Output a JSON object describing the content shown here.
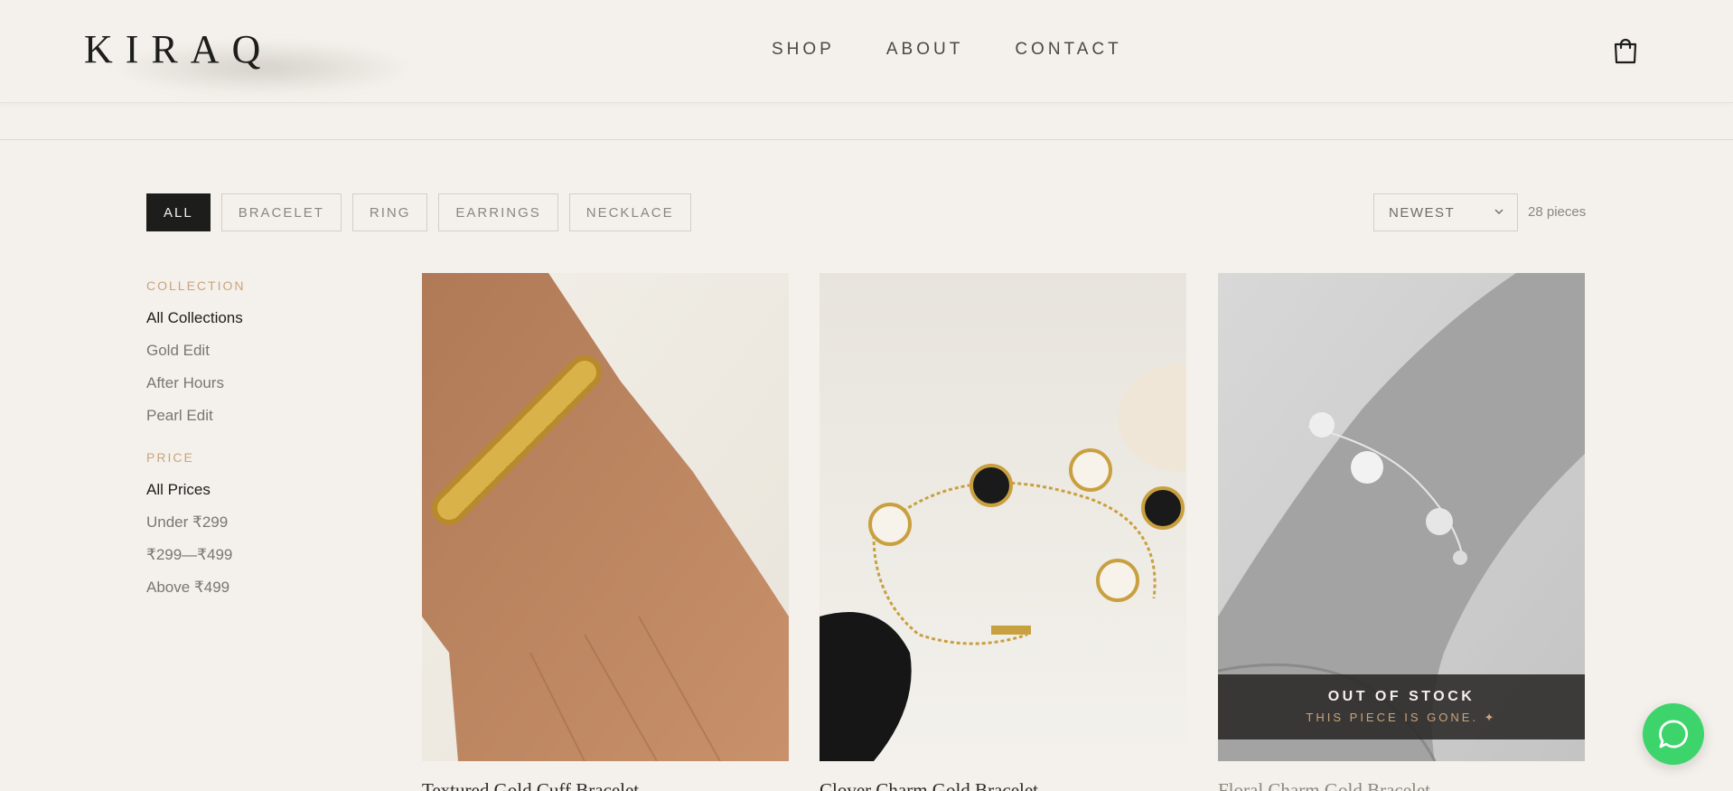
{
  "brand": {
    "logo": "KIRAQ"
  },
  "nav": {
    "shop": "SHOP",
    "about": "ABOUT",
    "contact": "CONTACT"
  },
  "header": {
    "cart_icon": "shopping-bag-icon"
  },
  "filters": {
    "chips": [
      "ALL",
      "BRACELET",
      "RING",
      "EARRINGS",
      "NECKLACE"
    ],
    "active": "ALL",
    "sort": {
      "selected": "NEWEST"
    },
    "count": "28 pieces"
  },
  "sidebar": {
    "collection": {
      "heading": "COLLECTION",
      "items": [
        "All Collections",
        "Gold Edit",
        "After Hours",
        "Pearl Edit"
      ],
      "selected": "All Collections"
    },
    "price": {
      "heading": "PRICE",
      "items": [
        "All Prices",
        "Under ₹299",
        "₹299—₹499",
        "Above ₹499"
      ],
      "selected": "All Prices"
    }
  },
  "products": [
    {
      "title": "Textured Gold Cuff Bracelet",
      "stock": "in"
    },
    {
      "title": "Clover Charm Gold Bracelet",
      "stock": "in"
    },
    {
      "title": "Floral Charm Gold Bracelet",
      "stock": "out",
      "badge_title": "OUT OF STOCK",
      "badge_sub": "THIS PIECE IS GONE. ✦"
    }
  ],
  "chat": {
    "icon": "chat-bubble-icon",
    "color": "#3dd46b"
  },
  "colors": {
    "background": "#f4f1ec",
    "ink": "#1d1d1b",
    "accent": "#c9a47a"
  }
}
